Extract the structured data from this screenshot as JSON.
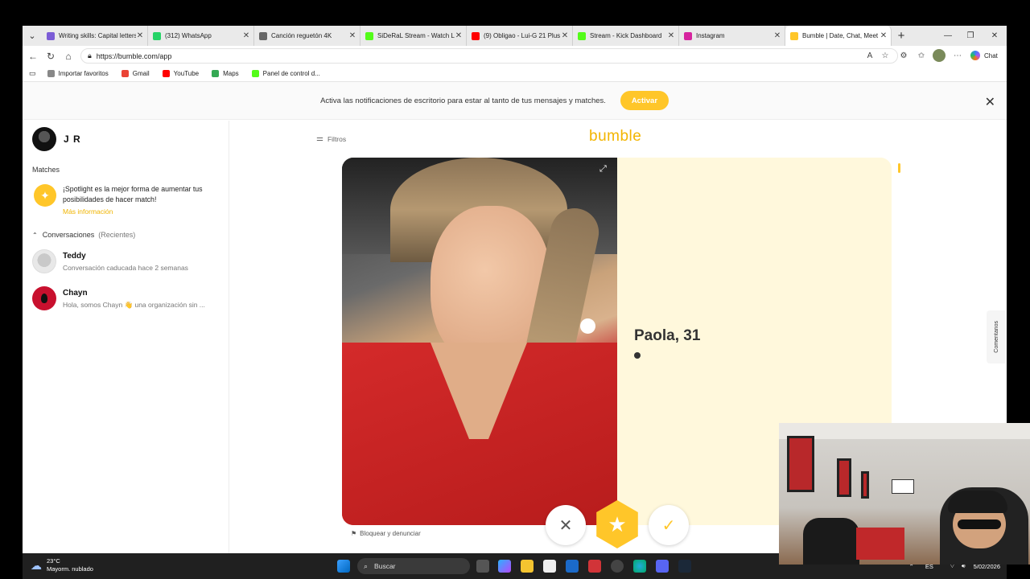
{
  "browser": {
    "tabs": [
      {
        "title": "Writing skills: Capital letters",
        "color": "#7b5cd6",
        "active": false
      },
      {
        "title": "(312) WhatsApp",
        "color": "#25d366",
        "active": false
      },
      {
        "title": "Canción reguetón 4K",
        "color": "#666666",
        "active": false
      },
      {
        "title": "SiDeRaL Stream - Watch Live",
        "color": "#53fc18",
        "active": false
      },
      {
        "title": "(9) Obligao - Lui-G 21 Plus",
        "color": "#ff0000",
        "active": false
      },
      {
        "title": "Stream - Kick Dashboard",
        "color": "#53fc18",
        "active": false
      },
      {
        "title": "Instagram",
        "color": "#d6249f",
        "active": false
      },
      {
        "title": "Bumble | Date, Chat, Meet N",
        "color": "#ffc629",
        "active": true
      }
    ],
    "url": "https://bumble.com/app",
    "chat_label": "Chat",
    "bookmarks": [
      {
        "label": "Importar favoritos",
        "color": "#888888"
      },
      {
        "label": "Gmail",
        "color": "#ea4335"
      },
      {
        "label": "YouTube",
        "color": "#ff0000"
      },
      {
        "label": "Maps",
        "color": "#34a853"
      },
      {
        "label": "Panel de control d...",
        "color": "#53fc18"
      }
    ]
  },
  "notification": {
    "text": "Activa las notificaciones de escritorio para estar al tanto de tus mensajes y matches.",
    "button": "Activar"
  },
  "sidebar": {
    "user_name": "J R",
    "matches_heading": "Matches",
    "spotlight_text": "¡Spotlight es la mejor forma de aumentar tus posibilidades de hacer match!",
    "spotlight_link": "Más información",
    "conversations_heading": "Conversaciones",
    "conversations_sub": "(Recientes)",
    "conversations": [
      {
        "name": "Teddy",
        "message": "Conversación caducada hace 2 semanas"
      },
      {
        "name": "Chayn",
        "message": "Hola, somos Chayn 👋 una organización sin ..."
      }
    ]
  },
  "main": {
    "filters_label": "Filtros",
    "logo": "bumble",
    "profile_name_age": "Paola, 31",
    "block_report": "Bloquear y denunciar",
    "comments_tab": "Comentarios"
  },
  "taskbar": {
    "temperature": "23°C",
    "weather": "Mayorm. nublado",
    "search_placeholder": "Buscar",
    "lang": "ES",
    "date": "5/02/2026"
  },
  "colors": {
    "accent": "#ffc629",
    "card_bg": "#fff8dc"
  }
}
